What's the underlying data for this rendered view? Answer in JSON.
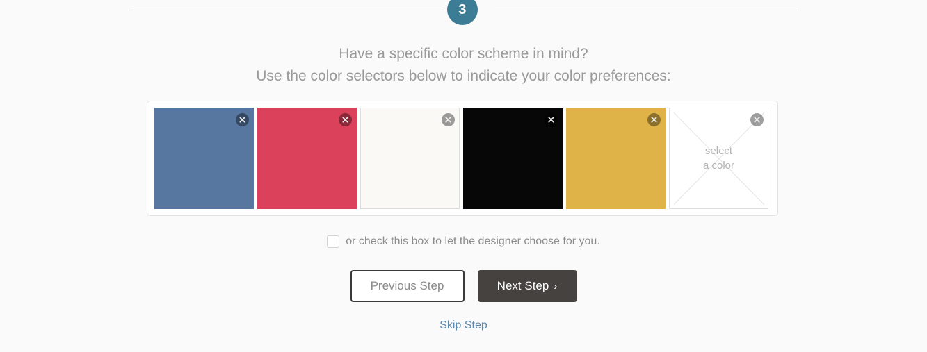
{
  "step": {
    "number": "3",
    "circle_color": "#3c7c94"
  },
  "prompt": {
    "line1": "Have a specific color scheme in mind?",
    "line2": "Use the color selectors below to indicate your color preferences:"
  },
  "swatches": [
    {
      "color": "#5777a0",
      "removable": true,
      "empty": false,
      "bordered": false
    },
    {
      "color": "#dc415c",
      "removable": true,
      "empty": false,
      "bordered": false
    },
    {
      "color": "#faf9f6",
      "removable": true,
      "empty": false,
      "bordered": true
    },
    {
      "color": "#070707",
      "removable": true,
      "empty": false,
      "bordered": false
    },
    {
      "color": "#dfb348",
      "removable": true,
      "empty": false,
      "bordered": false
    },
    {
      "color": "#ffffff",
      "removable": true,
      "empty": true,
      "bordered": true,
      "placeholder_line1": "select",
      "placeholder_line2": "a color"
    }
  ],
  "checkbox": {
    "checked": false,
    "label": "or check this box to let the designer choose for you."
  },
  "buttons": {
    "previous_label": "Previous Step",
    "next_label": "Next Step",
    "next_chevron": "›"
  },
  "skip": {
    "label": "Skip Step",
    "color": "#5b88ad"
  }
}
